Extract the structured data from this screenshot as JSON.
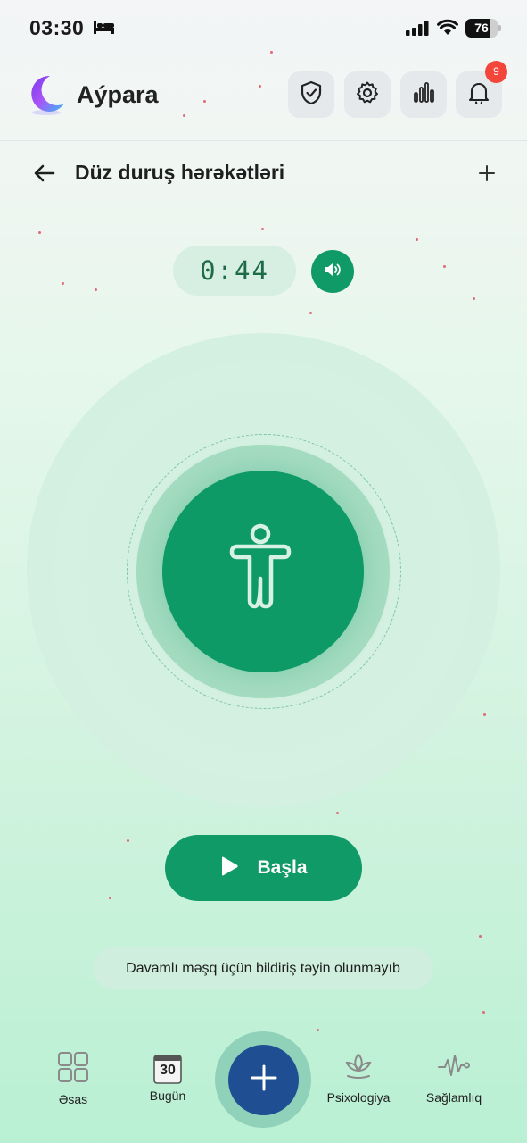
{
  "status_bar": {
    "time": "03:30",
    "battery": "76",
    "battery_level": 0.76
  },
  "header": {
    "brand": "Aýpara",
    "notification_count": "9"
  },
  "title_bar": {
    "title": "Düz duruş hərəkətləri"
  },
  "timer": {
    "display": "0:44"
  },
  "start_button": {
    "label": "Başla"
  },
  "notice": {
    "text": "Davamlı məşq üçün bildiriş təyin olunmayıb"
  },
  "bottom_nav": {
    "items": [
      {
        "label": "Əsas",
        "icon": "grid-icon"
      },
      {
        "label": "Bugün",
        "icon": "calendar-icon",
        "day": "30"
      },
      {
        "label": "Psixologiya",
        "icon": "lotus-icon"
      },
      {
        "label": "Sağlamlıq",
        "icon": "heartbeat-icon"
      }
    ],
    "fab_icon": "plus-icon"
  },
  "colors": {
    "accent": "#0f9a67",
    "fab": "#1f4e93",
    "badge": "#f2463a"
  }
}
